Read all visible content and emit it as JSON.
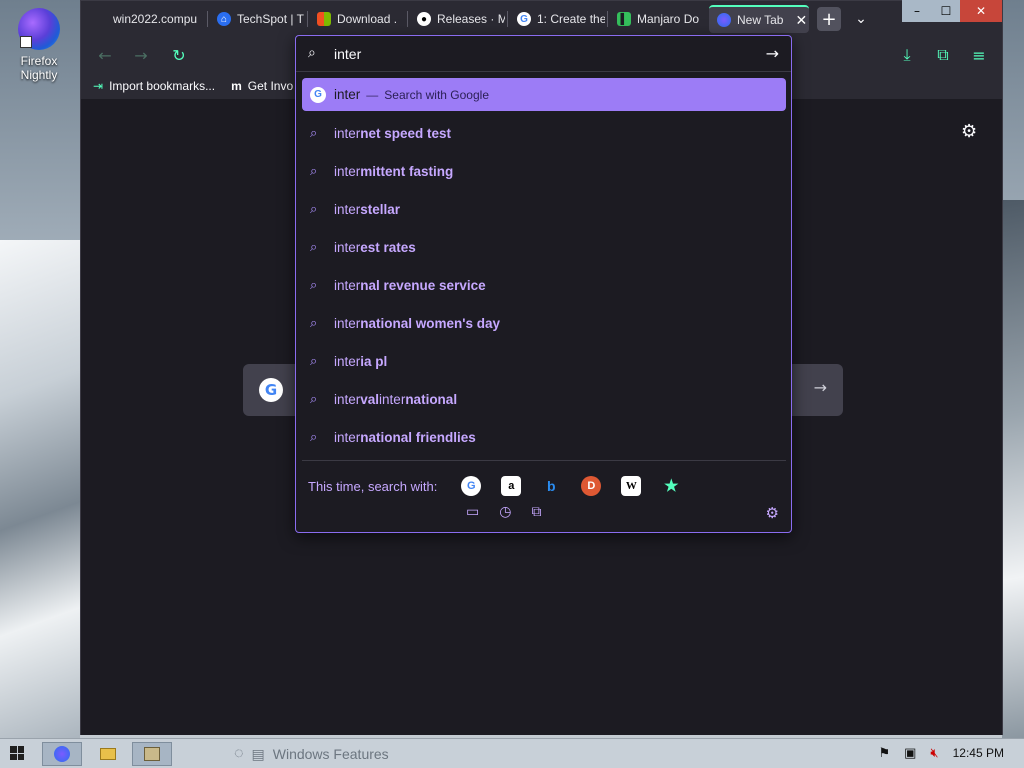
{
  "desktop": {
    "icon_label_1": "Firefox",
    "icon_label_2": "Nightly"
  },
  "tabs": [
    {
      "label": "win2022.compu",
      "favicon": "globe-icon"
    },
    {
      "label": "TechSpot | T",
      "favicon": "techspot-icon"
    },
    {
      "label": "Download .",
      "favicon": "microsoft-icon"
    },
    {
      "label": "Releases · M",
      "favicon": "github-icon"
    },
    {
      "label": "1: Create the",
      "favicon": "google-icon"
    },
    {
      "label": "Manjaro Do",
      "favicon": "manjaro-icon"
    },
    {
      "label": "New Tab",
      "favicon": "firefox-icon",
      "active": true
    }
  ],
  "window_controls": {
    "minimize": "–",
    "maximize": "☐",
    "close": "✕"
  },
  "bookmarks": [
    {
      "label": "Import bookmarks...",
      "icon": "import-icon"
    },
    {
      "label": "Get Invo",
      "icon": "m-icon"
    }
  ],
  "urlbar": {
    "value": "inter",
    "selected": {
      "typed": "inter",
      "dash": "—",
      "action": "Search with Google"
    },
    "suggestions": [
      {
        "typed": "inter",
        "comp": "net speed test"
      },
      {
        "typed": "inter",
        "comp": "mittent fasting"
      },
      {
        "typed": "inter",
        "comp": "stellar"
      },
      {
        "typed": "inter",
        "comp": "est rates"
      },
      {
        "typed": "inter",
        "comp": "nal revenue service"
      },
      {
        "typed": "inter",
        "comp": "national women's day"
      },
      {
        "typed": "inter",
        "comp": "ia pl"
      },
      {
        "typed": "inter",
        "comp": "val internat",
        "extra_typed": "",
        "full": "interval international"
      },
      {
        "typed": "inter",
        "comp": "national friendlies"
      }
    ],
    "oneoff_label": "This time, search with:",
    "engines": [
      "Google",
      "Amazon",
      "Bing",
      "DuckDuckGo",
      "Wikipedia",
      "Bookmark"
    ]
  },
  "taskbar": {
    "task_text": "Windows Features",
    "time": "12:45 PM"
  },
  "colors": {
    "accent": "#54ffbd",
    "purple": "#9c7cf6",
    "bg": "#1c1b22",
    "toolbar": "#2b2a33"
  }
}
